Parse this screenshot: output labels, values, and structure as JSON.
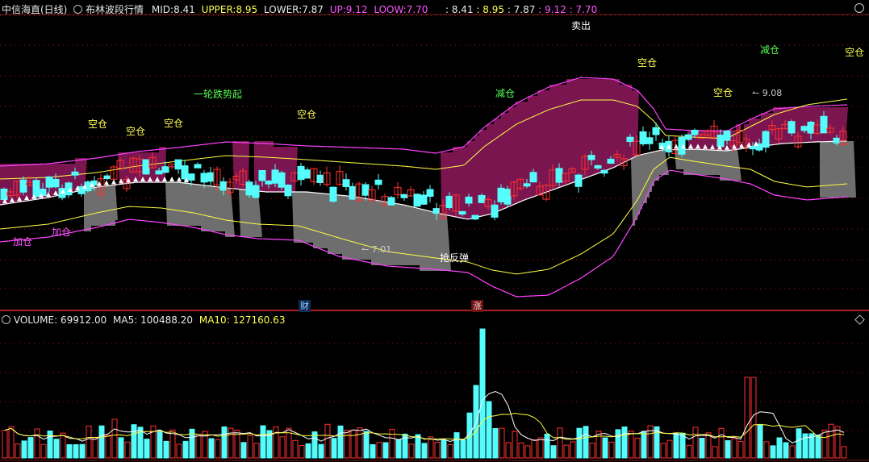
{
  "header": {
    "stock_name": "中信海直(日线)",
    "indicator_name": "布林波段行情",
    "mid_label": "MID:",
    "mid_value": "8.41",
    "upper_label": "UPPER:",
    "upper_value": "8.95",
    "lower_label": "LOWER:",
    "lower_value": "7.87",
    "up_label": "UP:",
    "up_value": "9.12",
    "loow_label": "LOOW:",
    "loow_value": "7.70",
    "extra_values": [
      ": 8.41",
      ": 8.95",
      ": 7.87",
      ": 9.12",
      ": 7.70"
    ]
  },
  "volume_header": {
    "volume_label": "VOLUME:",
    "volume_value": "69912.00",
    "ma5_label": "MA5:",
    "ma5_value": "100488.20",
    "ma10_label": "MA10:",
    "ma10_value": "127160.63"
  },
  "annotations": [
    {
      "text": "加仓",
      "color": "#ff55ff"
    },
    {
      "text": "加仓",
      "color": "#ff55ff"
    },
    {
      "text": "空仓",
      "color": "#ffff55"
    },
    {
      "text": "空仓",
      "color": "#ffff55"
    },
    {
      "text": "空仓",
      "color": "#ffff55"
    },
    {
      "text": "一轮跌势起",
      "color": "#55ff55"
    },
    {
      "text": "空仓",
      "color": "#ffff55"
    },
    {
      "text": "抢反弹",
      "color": "#ffffff"
    },
    {
      "text": "减仓",
      "color": "#55ff55"
    },
    {
      "text": "卖出",
      "color": "#ffffff"
    },
    {
      "text": "空仓",
      "color": "#ffff55"
    },
    {
      "text": "空仓",
      "color": "#ffff55"
    },
    {
      "text": "减仓",
      "color": "#55ff55"
    },
    {
      "text": "空仓",
      "color": "#ffff55"
    }
  ],
  "price_marks": {
    "low": "7.01",
    "high": "9.08"
  },
  "badges": {
    "cai": "财",
    "zhang": "涨"
  },
  "colors": {
    "up": "#ff3030",
    "down": "#54fcfc",
    "mid": "#ffffff",
    "band_inner": "#ffff44",
    "band_outer": "#ff44ff",
    "fill_bull": "#7a1550",
    "fill_bear": "#6e6e6e",
    "ma5": "#ffffff",
    "ma10": "#ffff44",
    "grid": "#a01818"
  },
  "chart_data": [
    {
      "type": "candlestick",
      "title": "布林波段行情",
      "series": [
        {
          "name": "MID",
          "last": 8.41
        },
        {
          "name": "UPPER",
          "last": 8.95
        },
        {
          "name": "LOWER",
          "last": 7.87
        },
        {
          "name": "UP",
          "last": 9.12
        },
        {
          "name": "LOOW",
          "last": 7.7
        }
      ],
      "ylim": [
        6.55,
        9.55
      ],
      "low_mark": 7.01,
      "high_mark": 9.08
    },
    {
      "type": "bar",
      "title": "VOLUME",
      "series": [
        {
          "name": "VOLUME",
          "last": 69912.0
        },
        {
          "name": "MA5",
          "last": 100488.2
        },
        {
          "name": "MA10",
          "last": 127160.63
        }
      ]
    }
  ]
}
